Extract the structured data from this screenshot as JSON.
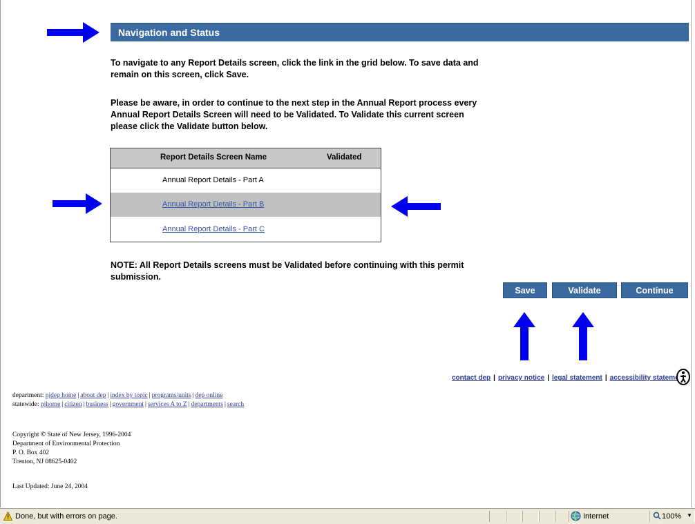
{
  "header": {
    "title": "Navigation and Status"
  },
  "instructions": {
    "p1": "To navigate to any Report Details screen, click the link in the grid below. To save data and remain on this screen, click Save.",
    "p2": "Please be aware, in order to continue to the next step in the Annual Report process every Annual Report Details Screen will need to be Validated. To Validate this current screen please click the Validate button below."
  },
  "grid": {
    "columns": [
      "Report Details Screen Name",
      "Validated"
    ],
    "rows": [
      {
        "name": "Annual Report Details - Part A",
        "validated": ""
      },
      {
        "name": "Annual Report Details - Part B",
        "validated": ""
      },
      {
        "name": "Annual Report Details - Part C",
        "validated": ""
      }
    ]
  },
  "note": "NOTE: All Report Details screens must be Validated before continuing with this permit submission.",
  "buttons": {
    "save": "Save",
    "validate": "Validate",
    "continue": "Continue"
  },
  "colors": {
    "header_bg": "#3a6aa0",
    "arrow": "#0000ee",
    "selected_row": "#c0c0c0"
  },
  "footer_links": {
    "contact": "contact dep",
    "privacy": "privacy notice",
    "legal": "legal statement",
    "accessibility": "accessibility statement",
    "separator": "|"
  },
  "department": {
    "label": "department:",
    "links": [
      "njdep home",
      "about dep",
      "index by topic",
      "programs/units",
      "dep online"
    ]
  },
  "statewide": {
    "label": "statewide:",
    "links": [
      "njhome",
      "citizen",
      "business",
      "government",
      "services A to Z",
      "departments",
      "search"
    ]
  },
  "copyright": {
    "line1": "Copyright",
    "line1b": "State of New Jersey, 1996-2004",
    "line2": "Department of Environmental Protection",
    "line3": "P. O. Box 402",
    "line4": "Trenton, NJ 08625-0402"
  },
  "last_updated": "Last Updated: June 24, 2004",
  "status_bar": {
    "message": "Done, but with errors on page.",
    "zone": "Internet",
    "zoom": "100%"
  }
}
